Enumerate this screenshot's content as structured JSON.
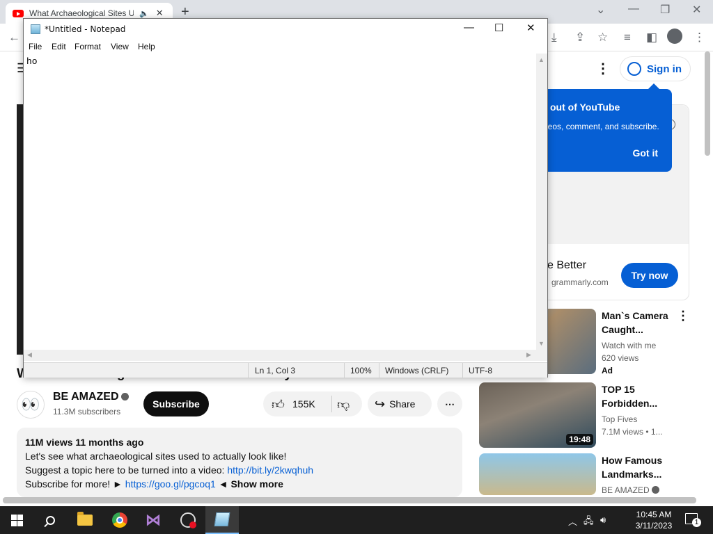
{
  "browser": {
    "tab_title": "What Archaeological Sites U",
    "audio_icon": "speaker-icon",
    "close_glyph": "✕",
    "newtab_glyph": "+"
  },
  "youtube": {
    "signin_label": "Sign in",
    "tooltip": {
      "title": "out of YouTube",
      "body": "deos, comment, and subscribe.",
      "button": "Got it"
    },
    "ad": {
      "title": "e Better",
      "domain": "grammarly.com",
      "cta": "Try now"
    },
    "video_title_partial": "What Archaeological Sites Used To Actually Look Like",
    "channel": {
      "name": "BE AMAZED",
      "subscribers": "11.3M subscribers"
    },
    "subscribe_label": "Subscribe",
    "likes": "155K",
    "share_label": "Share",
    "description": {
      "meta": "11M views  11 months ago",
      "line1": "Let's see what archaeological sites used to actually look like!",
      "line2_text": "Suggest a topic here to be turned into a video: ",
      "line2_link": "http://bit.ly/2kwqhuh",
      "line3_text": "Subscribe for more! ► ",
      "line3_link": "https://goo.gl/pgcoq1",
      "line3_after": " ◄ ",
      "show_more": "Show more"
    },
    "recommendations": [
      {
        "title": "Man`s Camera\nCaught...",
        "channel": "Watch with me",
        "views": "620 views",
        "badge": "Ad"
      },
      {
        "title": "TOP 15\nForbidden...",
        "channel": "Top Fives",
        "views": "7.1M views  • 1...",
        "duration": "19:48"
      },
      {
        "title": "How Famous\nLandmarks...",
        "channel": "BE AMAZED",
        "views": ""
      }
    ]
  },
  "notepad": {
    "title": "*Untitled - Notepad",
    "menu": [
      "File",
      "Edit",
      "Format",
      "View",
      "Help"
    ],
    "content": "ho",
    "status": {
      "position": "Ln 1, Col 3",
      "zoom": "100%",
      "line_ending": "Windows (CRLF)",
      "encoding": "UTF-8"
    }
  },
  "taskbar": {
    "time": "10:45 AM",
    "date": "3/11/2023",
    "notification_count": "1"
  }
}
